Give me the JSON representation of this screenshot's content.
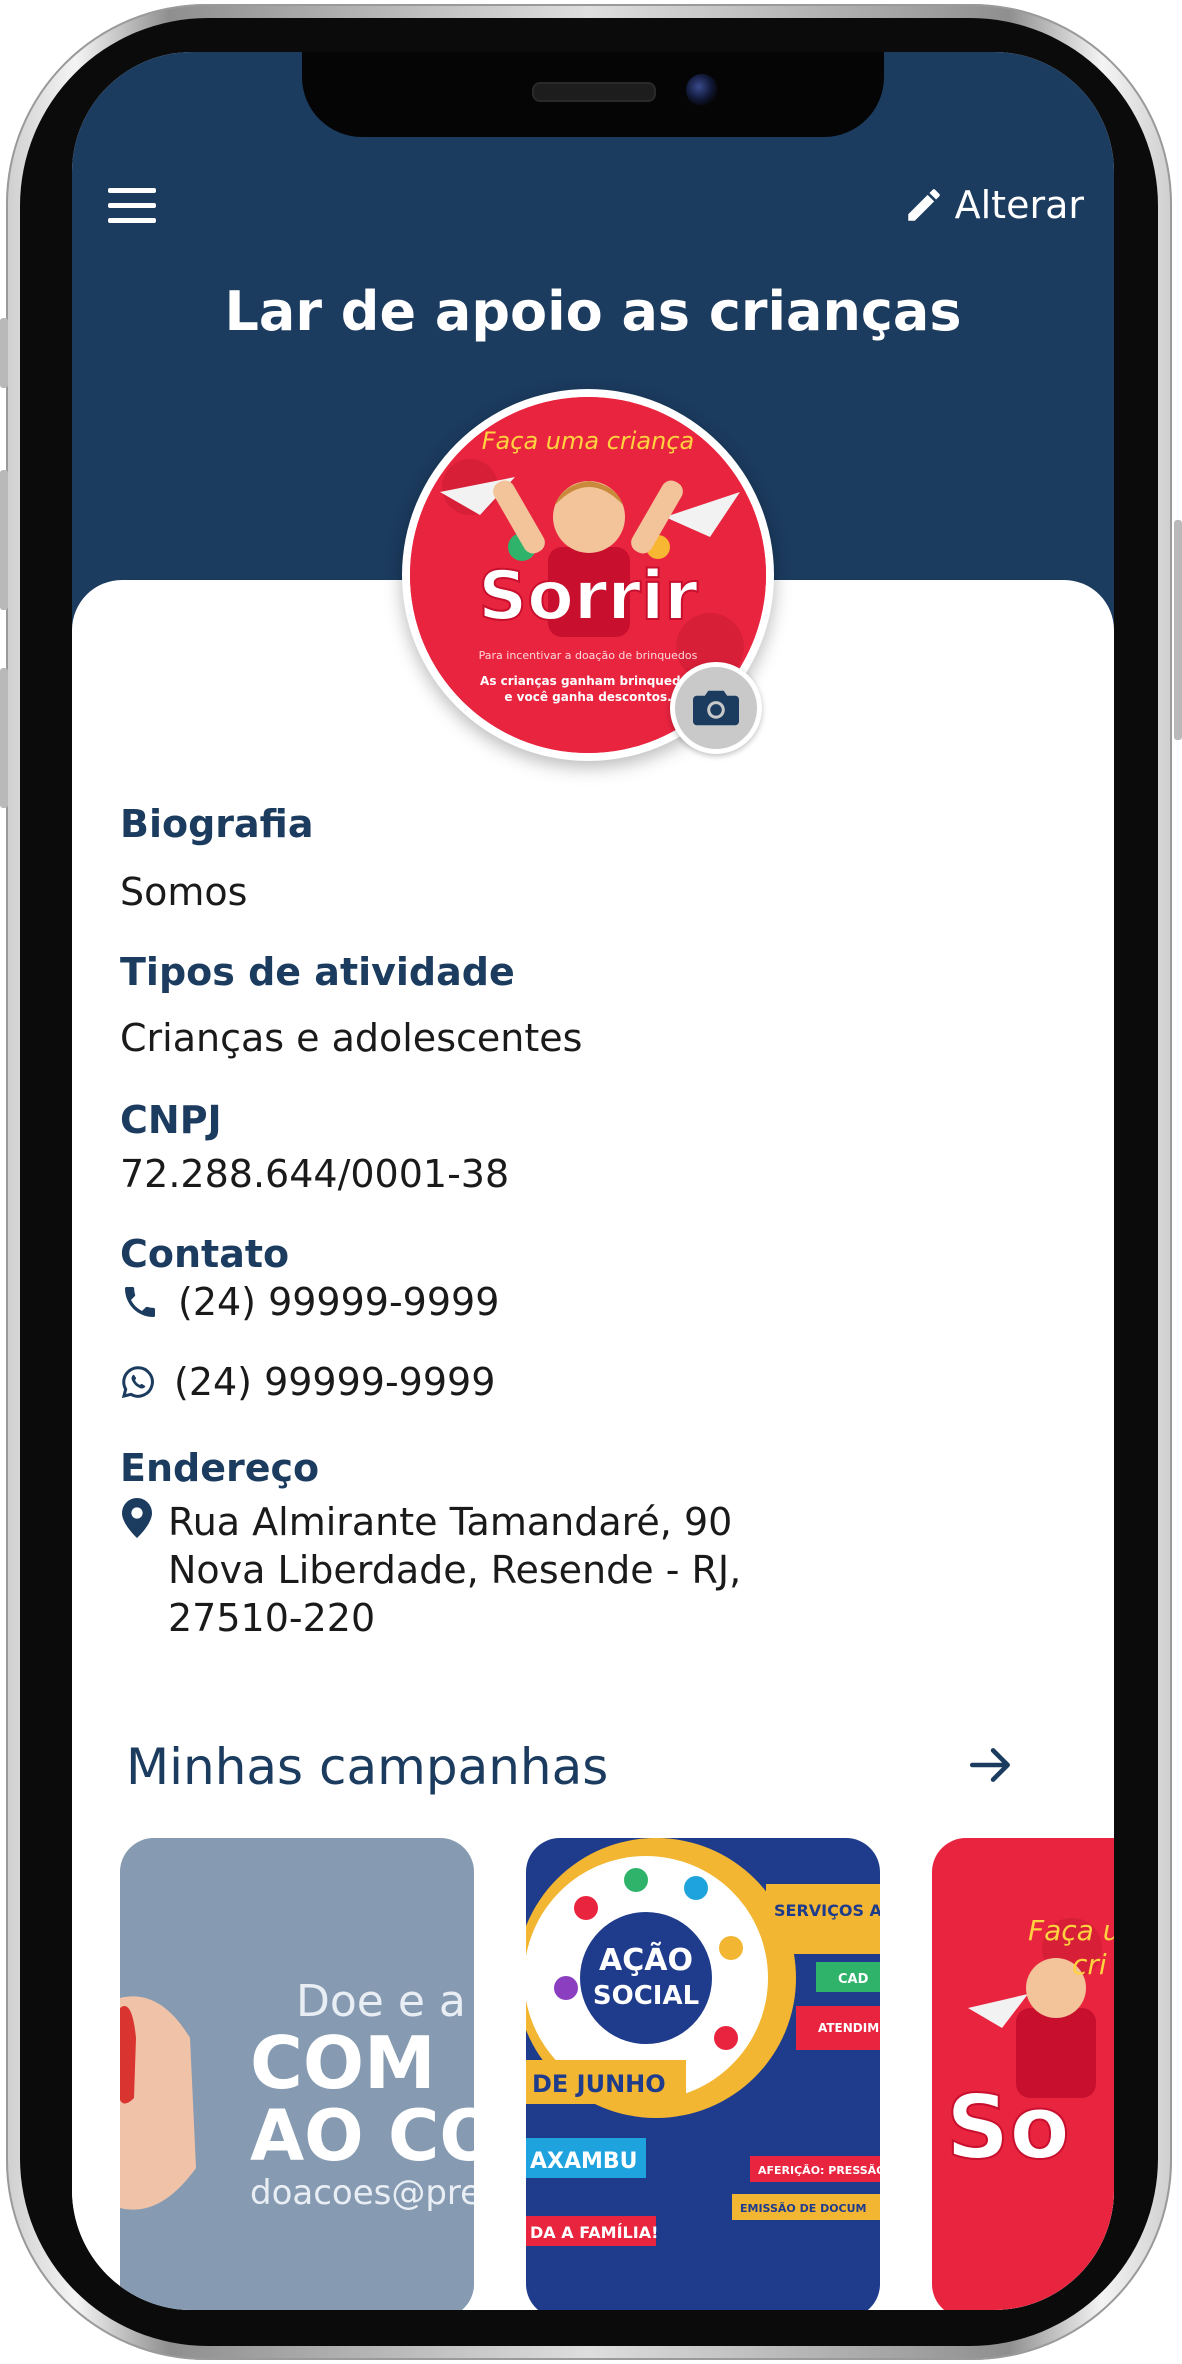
{
  "header": {
    "edit_label": "Alterar",
    "title": "Lar de apoio as crianças"
  },
  "avatar": {
    "poster_top": "Faça uma criança",
    "poster_word": "Sorrir",
    "poster_fine": "Para incentivar a doação de brinquedos",
    "poster_bottom_1": "As crianças ganham brinquedos",
    "poster_bottom_2": "e você ganha descontos."
  },
  "profile": {
    "bio_label": "Biografia",
    "bio_value": "Somos",
    "activity_label": "Tipos de atividade",
    "activity_value": "Crianças e adolescentes",
    "cnpj_label": "CNPJ",
    "cnpj_value": "72.288.644/0001-38",
    "contact_label": "Contato",
    "phone": "(24) 99999-9999",
    "whatsapp": "(24) 99999-9999",
    "address_label": "Endereço",
    "address_line1": "Rua Almirante Tamandaré, 90",
    "address_line2": "Nova Liberdade, Resende - RJ,",
    "address_line3": "27510-220"
  },
  "campaigns": {
    "title": "Minhas campanhas",
    "items": [
      {
        "line1": "Doe e a",
        "line2": "COM",
        "line3": "AO CO",
        "line4": "doacoes@pre"
      },
      {
        "badge_1": "AÇÃO",
        "badge_2": "SOCIAL",
        "banner": "SERVIÇOS A POPULA",
        "date": "DE JUNHO",
        "place": "AXAMBU",
        "row1": "CAD",
        "row2": "ATENDIM",
        "row3": "AFERIÇÃO: PRESSÃO E",
        "row4": "EMISSÃO DE DOCUM",
        "tag": "DA A FAMÍLIA!"
      },
      {
        "line1": "Faça um",
        "line2": "cri",
        "line3": "So"
      }
    ]
  },
  "colors": {
    "primary": "#1b3b5f",
    "poster_red": "#e8243f"
  }
}
